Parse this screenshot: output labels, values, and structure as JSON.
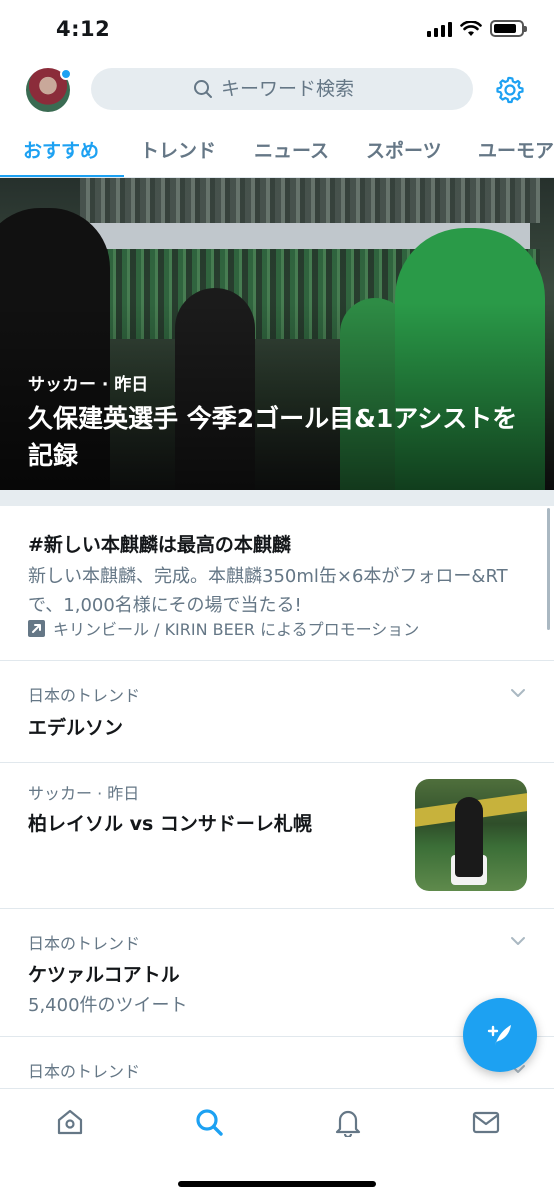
{
  "status_bar": {
    "time": "4:12",
    "battery_level": 0.85
  },
  "header": {
    "search_placeholder": "キーワード検索",
    "icons": [
      "avatar",
      "search-icon",
      "gear-icon"
    ],
    "accent_color": "#1da1f2"
  },
  "tabs": [
    {
      "label": "おすすめ",
      "active": true
    },
    {
      "label": "トレンド",
      "active": false
    },
    {
      "label": "ニュース",
      "active": false
    },
    {
      "label": "スポーツ",
      "active": false
    },
    {
      "label": "ユーモア",
      "active": false
    }
  ],
  "hero": {
    "meta": "サッカー · 昨日",
    "title": "久保建英選手 今季2ゴール目&1アシストを記録"
  },
  "promo": {
    "title": "#新しい本麒麟は最高の本麒麟",
    "description": "新しい本麒麟、完成。本麒麟350ml缶×6本がフォロー&RTで、1,000名様にその場で当たる!",
    "promoted_by": "キリンビール / KIRIN BEER によるプロモーション"
  },
  "trends": [
    {
      "meta": "日本のトレンド",
      "name": "エデルソン"
    },
    {
      "meta": "サッカー · 昨日",
      "name": "柏レイソル vs コンサドーレ札幌"
    },
    {
      "meta": "日本のトレンド",
      "name": "ケツァルコアトル",
      "count": "5,400件のツイート"
    },
    {
      "meta": "日本のトレンド"
    }
  ],
  "bottom_nav": [
    "home-icon",
    "search-icon",
    "notifications-icon",
    "messages-icon"
  ]
}
